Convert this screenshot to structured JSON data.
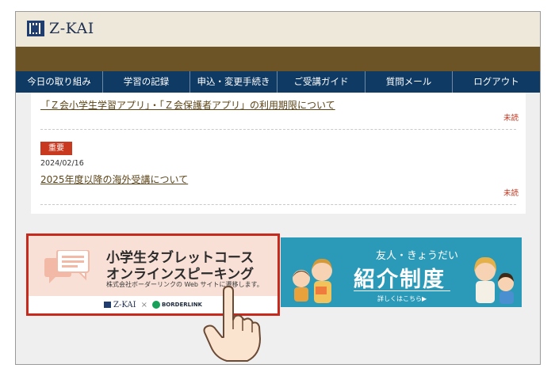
{
  "header": {
    "logo_text": "Z-KAI"
  },
  "nav": {
    "items": [
      {
        "label": "今日の取り組み"
      },
      {
        "label": "学習の記録"
      },
      {
        "label": "申込・変更手続き"
      },
      {
        "label": "ご受講ガイド"
      },
      {
        "label": "質問メール"
      },
      {
        "label": "ログアウト"
      }
    ]
  },
  "news": {
    "items": [
      {
        "title": "「Ｚ会小学生学習アプリ」・「Ｚ会保護者アプリ」の利用期限について",
        "status": "未読"
      },
      {
        "badge": "重要",
        "date": "2024/02/16",
        "title": "2025年度以降の海外受講について",
        "status": "未読"
      }
    ]
  },
  "banners": {
    "left": {
      "title_line1": "小学生タブレットコース",
      "title_line2": "オンラインスピーキング",
      "subtitle": "株式会社ボーダーリンクの Web サイトに遷移します。",
      "partner_logo_text": "Z-KAI",
      "partner_separator": "×",
      "partner_name": "BORDERLINK"
    },
    "right": {
      "top_text": "友人・きょうだい",
      "main_text": "紹介制度",
      "detail_text": "詳しくはこちら▶"
    }
  },
  "colors": {
    "nav_bg": "#0f3a63",
    "brown_band": "#6d5426",
    "highlight_border": "#c8291d",
    "important_badge": "#c8391f",
    "referral_banner": "#2b9ab8"
  },
  "icons": [
    "z-kai-logo-icon",
    "speech-bubble-icon",
    "pointing-hand-icon"
  ]
}
